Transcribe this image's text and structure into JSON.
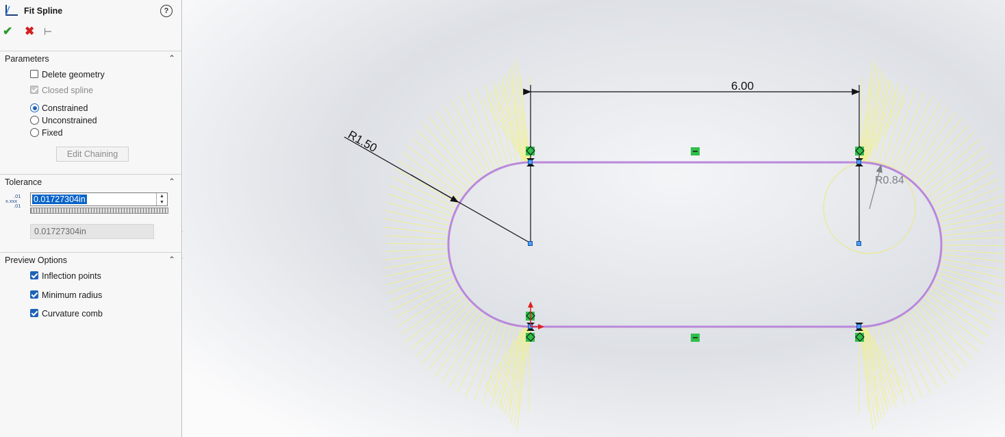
{
  "property_manager": {
    "title": "Fit Spline",
    "help_icon": "help-circle-icon",
    "actions": {
      "ok_icon": "check-icon",
      "cancel_icon": "x-icon",
      "pin_icon": "pushpin-icon"
    },
    "parameters": {
      "header": "Parameters",
      "delete_geometry": "Delete geometry",
      "closed_spline": "Closed spline",
      "constrained": "Constrained",
      "unconstrained": "Unconstrained",
      "fixed": "Fixed",
      "edit_chaining": "Edit Chaining"
    },
    "tolerance": {
      "header": "Tolerance",
      "icon_text": [
        ".01",
        "x.xxx",
        ".01"
      ],
      "value": "0.01727304in",
      "readonly_value": "0.01727304in"
    },
    "preview_options": {
      "header": "Preview Options",
      "inflection_points": "Inflection points",
      "minimum_radius": "Minimum radius",
      "curvature_comb": "Curvature comb"
    }
  },
  "sketch": {
    "dimension_width": "6.00",
    "dimension_radius": "R1.50",
    "minimum_radius_label": "R0.84"
  },
  "colors": {
    "spline": "#b189e4",
    "comb": "#f3f39a",
    "relation": "#2fbf4a",
    "selection": "#0a64c8"
  }
}
